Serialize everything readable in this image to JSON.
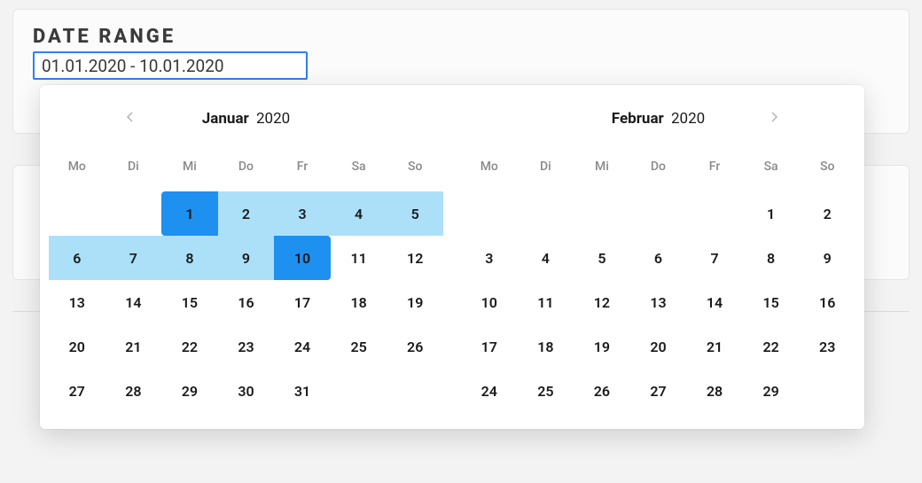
{
  "panel": {
    "title": "DATE RANGE",
    "input_value": "01.01.2020 - 10.01.2020"
  },
  "datepicker": {
    "weekday_labels": [
      "Mo",
      "Di",
      "Mi",
      "Do",
      "Fr",
      "Sa",
      "So"
    ],
    "range": {
      "start": "2020-01-01",
      "end": "2020-01-10"
    },
    "months": [
      {
        "name": "Januar",
        "year": "2020",
        "days": [
          {
            "d": "",
            "t": "empty"
          },
          {
            "d": "",
            "t": "empty"
          },
          {
            "d": "1",
            "t": "range-start"
          },
          {
            "d": "2",
            "t": "in-range"
          },
          {
            "d": "3",
            "t": "in-range"
          },
          {
            "d": "4",
            "t": "in-range muted"
          },
          {
            "d": "5",
            "t": "in-range muted"
          },
          {
            "d": "6",
            "t": "in-range"
          },
          {
            "d": "7",
            "t": "in-range"
          },
          {
            "d": "8",
            "t": "in-range"
          },
          {
            "d": "9",
            "t": "in-range"
          },
          {
            "d": "10",
            "t": "range-end"
          },
          {
            "d": "11",
            "t": "muted"
          },
          {
            "d": "12",
            "t": "muted"
          },
          {
            "d": "13",
            "t": ""
          },
          {
            "d": "14",
            "t": ""
          },
          {
            "d": "15",
            "t": ""
          },
          {
            "d": "16",
            "t": ""
          },
          {
            "d": "17",
            "t": ""
          },
          {
            "d": "18",
            "t": "muted"
          },
          {
            "d": "19",
            "t": "muted"
          },
          {
            "d": "20",
            "t": ""
          },
          {
            "d": "21",
            "t": ""
          },
          {
            "d": "22",
            "t": ""
          },
          {
            "d": "23",
            "t": ""
          },
          {
            "d": "24",
            "t": ""
          },
          {
            "d": "25",
            "t": "muted"
          },
          {
            "d": "26",
            "t": "muted"
          },
          {
            "d": "27",
            "t": ""
          },
          {
            "d": "28",
            "t": ""
          },
          {
            "d": "29",
            "t": ""
          },
          {
            "d": "30",
            "t": ""
          },
          {
            "d": "31",
            "t": ""
          },
          {
            "d": "",
            "t": "empty"
          },
          {
            "d": "",
            "t": "empty"
          }
        ]
      },
      {
        "name": "Februar",
        "year": "2020",
        "days": [
          {
            "d": "",
            "t": "empty"
          },
          {
            "d": "",
            "t": "empty"
          },
          {
            "d": "",
            "t": "empty"
          },
          {
            "d": "",
            "t": "empty"
          },
          {
            "d": "",
            "t": "empty"
          },
          {
            "d": "1",
            "t": "muted"
          },
          {
            "d": "2",
            "t": "muted"
          },
          {
            "d": "3",
            "t": ""
          },
          {
            "d": "4",
            "t": ""
          },
          {
            "d": "5",
            "t": ""
          },
          {
            "d": "6",
            "t": ""
          },
          {
            "d": "7",
            "t": ""
          },
          {
            "d": "8",
            "t": "muted"
          },
          {
            "d": "9",
            "t": "muted"
          },
          {
            "d": "10",
            "t": ""
          },
          {
            "d": "11",
            "t": ""
          },
          {
            "d": "12",
            "t": ""
          },
          {
            "d": "13",
            "t": ""
          },
          {
            "d": "14",
            "t": ""
          },
          {
            "d": "15",
            "t": "muted"
          },
          {
            "d": "16",
            "t": "muted"
          },
          {
            "d": "17",
            "t": ""
          },
          {
            "d": "18",
            "t": ""
          },
          {
            "d": "19",
            "t": ""
          },
          {
            "d": "20",
            "t": ""
          },
          {
            "d": "21",
            "t": ""
          },
          {
            "d": "22",
            "t": "muted"
          },
          {
            "d": "23",
            "t": "muted"
          },
          {
            "d": "24",
            "t": ""
          },
          {
            "d": "25",
            "t": ""
          },
          {
            "d": "26",
            "t": ""
          },
          {
            "d": "27",
            "t": ""
          },
          {
            "d": "28",
            "t": ""
          },
          {
            "d": "29",
            "t": "muted"
          },
          {
            "d": "",
            "t": "empty"
          }
        ]
      }
    ]
  }
}
